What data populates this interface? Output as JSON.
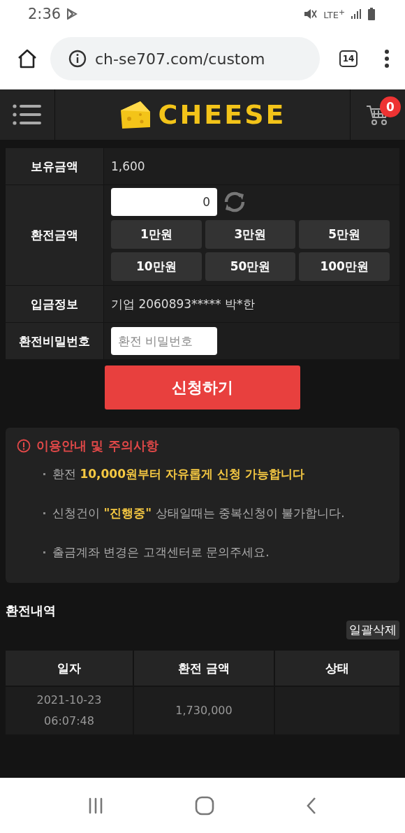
{
  "status_bar": {
    "time": "2:36",
    "network": "LTE$^{+}$"
  },
  "browser": {
    "url": "ch-se707.com/custom",
    "tab_count": "14"
  },
  "header": {
    "logo": "CHEESE",
    "cart_count": "0"
  },
  "form": {
    "balance_label": "보유금액",
    "balance": "1,600",
    "amount_label": "환전금액",
    "amount_value": "0",
    "quick_amounts": [
      "1만원",
      "3만원",
      "5만원",
      "10만원",
      "50만원",
      "100만원"
    ],
    "deposit_label": "입금정보",
    "deposit_info": "기업 2060893***** 박*한",
    "password_label": "환전비밀번호",
    "password_placeholder": "환전 비밀번호",
    "submit": "신청하기"
  },
  "notice": {
    "title": "이용안내 및 주의사항",
    "items": [
      "환전 **10,000원부터 자유롭게 신청 가능합니다**",
      "신청건이 **\"진행중\"** 상태일때는 중복신청이 불가합니다.",
      "출금계좌 변경은 고객센터로 문의주세요."
    ]
  },
  "history": {
    "title": "환전내역",
    "delete_all": "일괄삭제",
    "columns": [
      "일자",
      "환전 금액",
      "상태"
    ],
    "rows": [
      {
        "date": "2021-10-23",
        "time": "06:07:48",
        "amount": "1,730,000"
      }
    ]
  }
}
